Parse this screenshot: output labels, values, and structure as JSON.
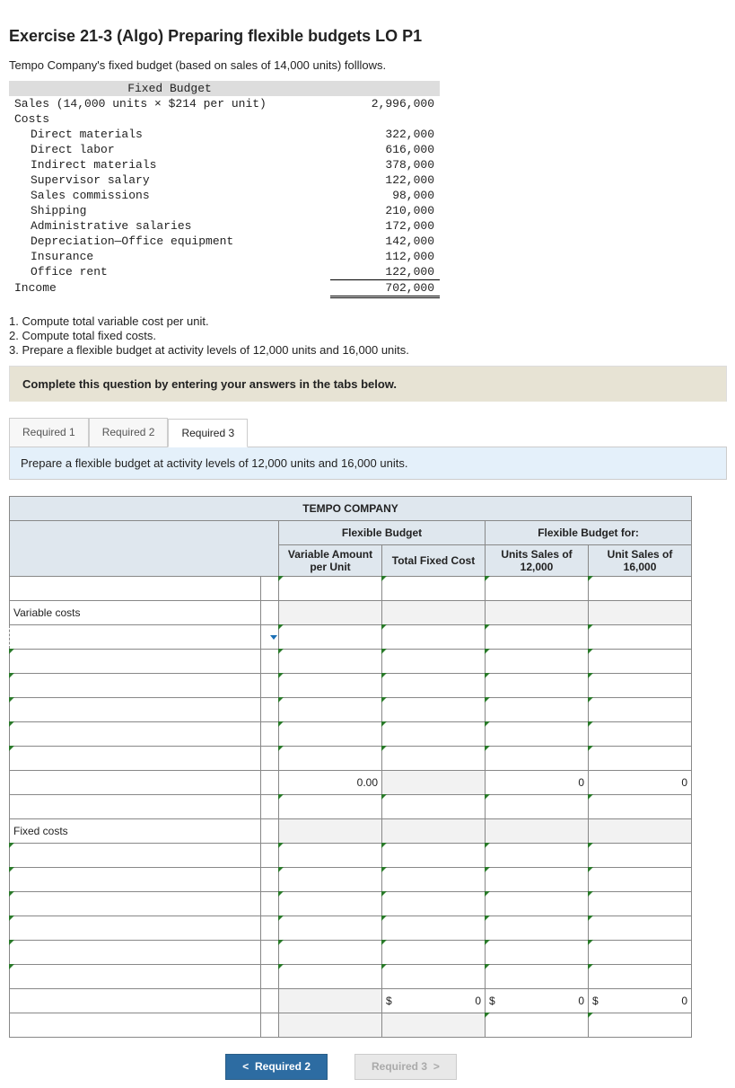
{
  "title": "Exercise 21-3 (Algo) Preparing flexible budgets LO P1",
  "intro": "Tempo Company's fixed budget (based on sales of 14,000 units) folllows.",
  "fixed_budget": {
    "header": "Fixed Budget",
    "rows": [
      {
        "label": "Sales (14,000 units × $214 per unit)",
        "value": "2,996,000",
        "indent": 0
      },
      {
        "label": "Costs",
        "value": "",
        "indent": 0
      },
      {
        "label": "Direct materials",
        "value": "322,000",
        "indent": 1
      },
      {
        "label": "Direct labor",
        "value": "616,000",
        "indent": 1
      },
      {
        "label": "Indirect materials",
        "value": "378,000",
        "indent": 1
      },
      {
        "label": "Supervisor salary",
        "value": "122,000",
        "indent": 1
      },
      {
        "label": "Sales commissions",
        "value": "98,000",
        "indent": 1
      },
      {
        "label": "Shipping",
        "value": "210,000",
        "indent": 1
      },
      {
        "label": "Administrative salaries",
        "value": "172,000",
        "indent": 1
      },
      {
        "label": "Depreciation—Office equipment",
        "value": "142,000",
        "indent": 1
      },
      {
        "label": "Insurance",
        "value": "112,000",
        "indent": 1
      },
      {
        "label": "Office rent",
        "value": "122,000",
        "indent": 1
      },
      {
        "label": "Income",
        "value": "702,000",
        "indent": 0
      }
    ]
  },
  "requirements": [
    "1. Compute total variable cost per unit.",
    "2. Compute total fixed costs.",
    "3. Prepare a flexible budget at activity levels of 12,000 units and 16,000 units."
  ],
  "instruction": "Complete this question by entering your answers in the tabs below.",
  "tabs": {
    "items": [
      "Required 1",
      "Required 2",
      "Required 3"
    ],
    "active": 2,
    "desc": "Prepare a flexible budget at activity levels of 12,000 units and 16,000 units."
  },
  "flex_budget": {
    "company": "TEMPO COMPANY",
    "h1_left": "Flexible Budget",
    "h1_right": "Flexible Budget for:",
    "h2": {
      "c1": "Variable Amount per Unit",
      "c2": "Total Fixed Cost",
      "c3": "Units Sales of 12,000",
      "c4": "Unit Sales of 16,000"
    },
    "section1": "Variable costs",
    "section2": "Fixed costs",
    "totals_row": {
      "c1": "0.00",
      "c3": "0",
      "c4": "0"
    },
    "grand_row": {
      "c2_sym": "$",
      "c2": "0",
      "c3_sym": "$",
      "c3": "0",
      "c4_sym": "$",
      "c4": "0"
    }
  },
  "pager": {
    "prev": "Required 2",
    "next": "Required 3"
  }
}
